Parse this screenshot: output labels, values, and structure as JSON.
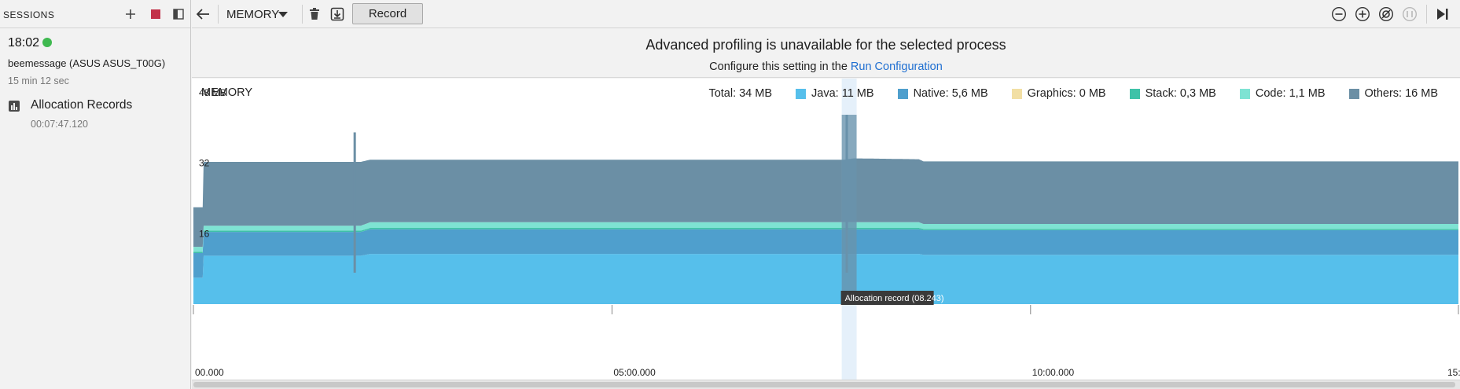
{
  "sessions": {
    "title": "SESSIONS",
    "session": {
      "time": "18:02",
      "device": "beemessage (ASUS ASUS_T00G)",
      "duration": "15 min 12 sec"
    },
    "allocation_item": {
      "label": "Allocation Records",
      "time": "00:07:47.120"
    }
  },
  "toolbar": {
    "profiler": "MEMORY",
    "record_label": "Record"
  },
  "banner": {
    "title": "Advanced profiling is unavailable for the selected process",
    "prefix": "Configure this setting in the ",
    "link": "Run Configuration"
  },
  "memory": {
    "title": "MEMORY",
    "total": "Total: 34 MB",
    "legend": [
      {
        "label": "Java: 11 MB",
        "color": "#56bfeb"
      },
      {
        "label": "Native: 5,6 MB",
        "color": "#4f9fcd"
      },
      {
        "label": "Graphics: 0 MB",
        "color": "#f2dfa4"
      },
      {
        "label": "Stack: 0,3 MB",
        "color": "#3fc2a8"
      },
      {
        "label": "Code: 1,1 MB",
        "color": "#7ee3d3"
      },
      {
        "label": "Others: 16 MB",
        "color": "#6b8fa5"
      }
    ],
    "tooltip": "Allocation record (08.243)"
  },
  "chart_data": {
    "type": "area",
    "unit": "MB",
    "y_ticks": [
      "48 MB",
      "32",
      "16"
    ],
    "ylim": [
      0,
      48
    ],
    "x_ticks": [
      "00.000",
      "05:00.000",
      "10:00.000",
      "15:"
    ],
    "series": [
      {
        "name": "Java",
        "color": "#56bfeb",
        "points": [
          [
            0,
            6
          ],
          [
            10,
            6
          ],
          [
            10,
            11
          ],
          [
            180,
            11
          ],
          [
            190,
            11.4
          ],
          [
            700,
            11.4
          ],
          [
            700,
            11.4
          ],
          [
            780,
            11.4
          ],
          [
            785,
            11.2
          ],
          [
            1360,
            11.2
          ]
        ]
      },
      {
        "name": "Native",
        "color": "#4f9fcd",
        "points": [
          [
            0,
            5.6
          ],
          [
            10,
            5.6
          ],
          [
            10,
            5.4
          ],
          [
            180,
            5.4
          ],
          [
            190,
            5.6
          ],
          [
            700,
            5.6
          ],
          [
            780,
            5.6
          ],
          [
            785,
            5.6
          ],
          [
            1360,
            5.6
          ]
        ]
      },
      {
        "name": "Stack",
        "color": "#3fc2a8",
        "points": [
          [
            0,
            0.3
          ],
          [
            1360,
            0.3
          ]
        ]
      },
      {
        "name": "Code",
        "color": "#7ee3d3",
        "points": [
          [
            0,
            1.1
          ],
          [
            10,
            1.1
          ],
          [
            180,
            1.1
          ],
          [
            190,
            1.3
          ],
          [
            780,
            1.3
          ],
          [
            785,
            1.1
          ],
          [
            1360,
            1.1
          ]
        ]
      },
      {
        "name": "Others",
        "color": "#6b8fa5",
        "points": [
          [
            0,
            9
          ],
          [
            10,
            9
          ],
          [
            10,
            14.5
          ],
          [
            180,
            14.5
          ],
          [
            190,
            14.2
          ],
          [
            700,
            14.2
          ],
          [
            710,
            14.5
          ],
          [
            780,
            14.3
          ],
          [
            785,
            14.2
          ],
          [
            1360,
            14.2
          ]
        ]
      }
    ],
    "spikes": [
      {
        "x": 173,
        "total": 39
      },
      {
        "x": 702,
        "total": 43
      }
    ],
    "selection": {
      "from": 697,
      "to": 713
    }
  }
}
